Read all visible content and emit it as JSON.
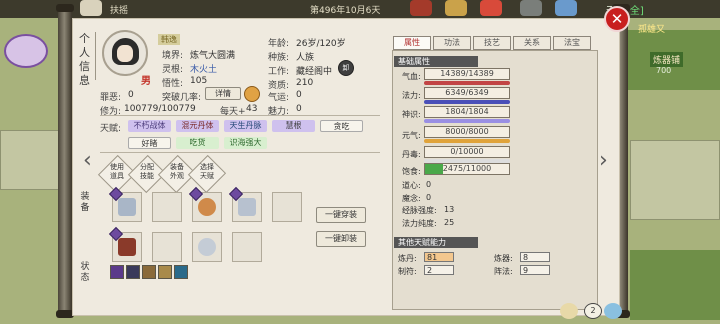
{
  "topbar": {
    "city": "扶摇",
    "date": "第496年10月6天",
    "safe_prefix": "天",
    "safe_text": "[安全]"
  },
  "map_labels": {
    "label1": "孤雄又",
    "label2": "炼器铺",
    "label3": "700"
  },
  "vertical_tabs": {
    "personal_info": "个人信息",
    "equipment": "装备",
    "status": "状态"
  },
  "profile": {
    "name": "韩逸",
    "gender": "男",
    "realm_label": "境界:",
    "realm_value": "炼气大圆满",
    "root_label": "灵根:",
    "root_value": "木火土",
    "insight_label": "悟性:",
    "insight_value": "105",
    "evil_label": "罪恶:",
    "evil_value": "0",
    "breakthrough_label": "突破几率:",
    "details_button": "详情",
    "cultivation_label": "修为:",
    "cultivation_value": "100779/100779",
    "per_day_label": "每天+",
    "per_day_value": "43",
    "age_label": "年龄:",
    "age_value": "26岁/120岁",
    "race_label": "种族:",
    "race_value": "人族",
    "job_label": "工作:",
    "job_value": "藏经阁中",
    "aptitude_label": "资质:",
    "aptitude_value": "210",
    "luck_label": "气运:",
    "luck_value": "0",
    "charm_label": "魅力:",
    "charm_value": "0",
    "badge_text": "卸",
    "talent_label": "天赋:",
    "talents": [
      {
        "label": "不朽战体",
        "color": "#cfc1ee",
        "text_color": "#4a3a7a"
      },
      {
        "label": "混元丹体",
        "color": "#cfc1ee",
        "text_color": "#7a2a2a"
      },
      {
        "label": "天生丹脉",
        "color": "#cfc1ee",
        "text_color": "#2a4a7a"
      },
      {
        "label": "慧根",
        "color": "#cfc1ee",
        "text_color": "#3a3a3a"
      },
      {
        "label": "贪吃",
        "color": "#f7f4ec",
        "text_color": "#333333"
      },
      {
        "label": "好睹",
        "color": "#f7f4ec",
        "text_color": "#333333"
      },
      {
        "label": "吃货",
        "color": "#d8efcf",
        "text_color": "#2e6a2e"
      },
      {
        "label": "识海强大",
        "color": "#d8efcf",
        "text_color": "#2e6a2e"
      }
    ]
  },
  "actions": [
    {
      "line1": "使用",
      "line2": "道具"
    },
    {
      "line1": "分配",
      "line2": "技能"
    },
    {
      "line1": "装备",
      "line2": "外观"
    },
    {
      "line1": "选择",
      "line2": "天赋"
    }
  ],
  "equip_buttons": {
    "equip_all": "一键穿装",
    "unequip_all": "一键卸装"
  },
  "right_tabs": [
    "属性",
    "功法",
    "技艺",
    "关系",
    "法宝"
  ],
  "attributes": {
    "header": "基础属性",
    "hp_label": "气血:",
    "hp_value": "14389/14389",
    "hp_fraction": 1.0,
    "mp_label": "法力:",
    "mp_value": "6349/6349",
    "mp_fraction": 1.0,
    "spirit_label": "神识:",
    "spirit_value": "1804/1804",
    "spirit_fraction": 1.0,
    "qi_label": "元气:",
    "qi_value": "8000/8000",
    "qi_fraction": 1.0,
    "poison_label": "丹毒:",
    "poison_value": "0/10000",
    "poison_fraction": 0.0,
    "satiety_label": "饱食:",
    "satiety_value": "2475/11000",
    "satiety_fraction": 0.225,
    "xinsu_label": "道心:",
    "xinsu_value": "0",
    "mozhi_label": "魔念:",
    "mozhi_value": "0",
    "meridian_label": "经脉强度:",
    "meridian_value": "13",
    "mana_purity_label": "法力纯度:",
    "mana_purity_value": "25",
    "other_header": "其他天赋能力",
    "alchemy_label": "炼丹:",
    "alchemy_value": "81",
    "forge_label": "炼器:",
    "forge_value": "8",
    "talisman_label": "制符:",
    "talisman_value": "2",
    "formation_label": "阵法:",
    "formation_value": "9"
  },
  "colors": {
    "hp_bar": "#c24545",
    "mp_bar": "#4a4fb8",
    "spirit_bar": "#9a8fe3",
    "qi_bar": "#e0a33a",
    "satiety_bar": "#4aa84a",
    "accent_red": "#c81f1f"
  },
  "bottom": {
    "page": "2"
  }
}
